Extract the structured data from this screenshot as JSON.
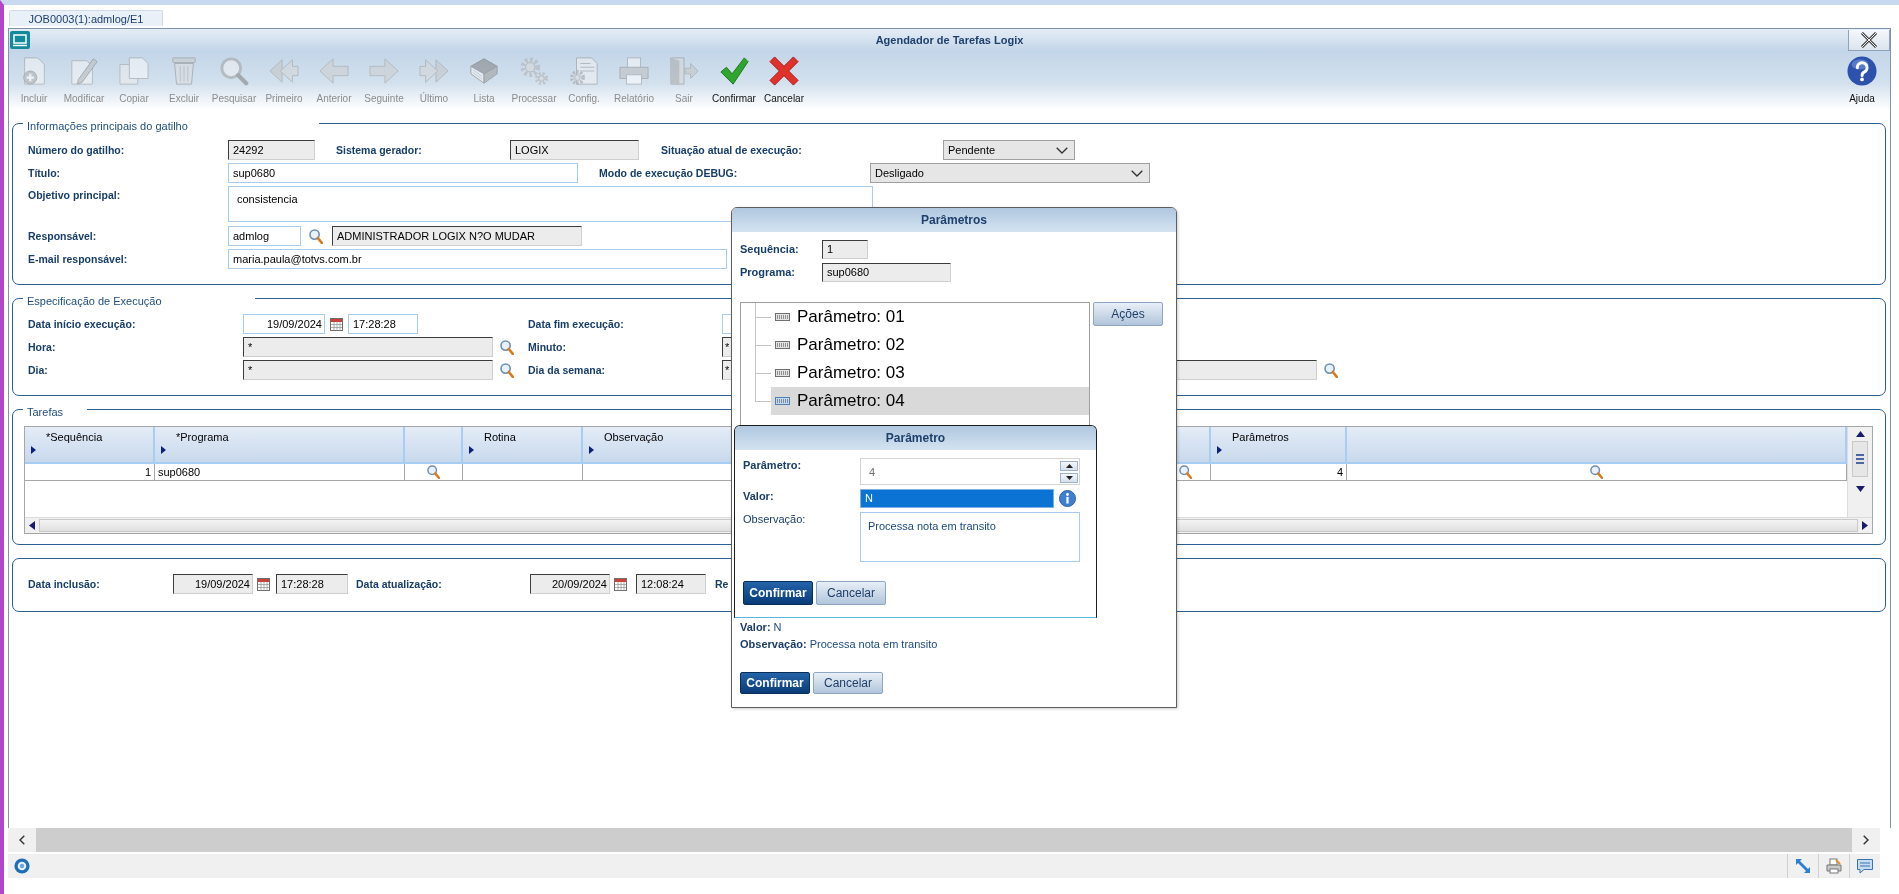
{
  "tabs": [
    {
      "label": "JOB0003(1):admlog/E1",
      "selected": true
    }
  ],
  "window": {
    "title": "Agendador de Tarefas Logix"
  },
  "toolbar": [
    {
      "label": "Incluir",
      "disabled": true
    },
    {
      "label": "Modificar",
      "disabled": true
    },
    {
      "label": "Copiar",
      "disabled": true
    },
    {
      "label": "Excluir",
      "disabled": true
    },
    {
      "label": "Pesquisar",
      "disabled": true
    },
    {
      "label": "Primeiro",
      "disabled": true
    },
    {
      "label": "Anterior",
      "disabled": true
    },
    {
      "label": "Seguinte",
      "disabled": true
    },
    {
      "label": "Último",
      "disabled": true
    },
    {
      "label": "Lista",
      "disabled": true
    },
    {
      "label": "Processar",
      "disabled": true
    },
    {
      "label": "Config.",
      "disabled": true
    },
    {
      "label": "Relatório",
      "disabled": true
    },
    {
      "label": "Sair",
      "disabled": true
    },
    {
      "label": "Confirmar",
      "disabled": false
    },
    {
      "label": "Cancelar",
      "disabled": false
    }
  ],
  "help": {
    "label": "Ajuda"
  },
  "trigger_info": {
    "legend": "Informações principais do gatilho",
    "trigger_number": {
      "label": "Número do gatilho:",
      "field": {
        "value": "24292",
        "readonly": true
      }
    },
    "source_system": {
      "label": "Sistema gerador:",
      "field": {
        "value": "LOGIX",
        "readonly": true
      }
    },
    "execution_status": {
      "label": "Situação atual de execução:",
      "value": "Pendente"
    },
    "title": {
      "label": "Título:",
      "field": {
        "value": "sup0680",
        "readonly": false
      }
    },
    "debug_mode": {
      "label": "Modo de execução DEBUG:",
      "value": "Desligado"
    },
    "objective": {
      "label": "Objetivo principal:",
      "value": "consistencia"
    },
    "owner": {
      "label": "Responsável:",
      "code": {
        "value": "admlog",
        "readonly": false
      },
      "name": {
        "value": "ADMINISTRADOR LOGIX N?O MUDAR",
        "readonly": true
      }
    },
    "owner_email": {
      "label": "E-mail responsável:",
      "field": {
        "value": "maria.paula@totvs.com.br",
        "readonly": false
      }
    }
  },
  "execution_spec": {
    "legend": "Especificação de Execução",
    "start": {
      "label": "Data início execução:",
      "date": {
        "value": "19/09/2024",
        "readonly": false
      },
      "time": {
        "value": "17:28:28",
        "readonly": false
      }
    },
    "end": {
      "label": "Data fim execução:",
      "date": {
        "readonly": false
      }
    },
    "hour": {
      "label": "Hora:",
      "field": {
        "value": "*",
        "readonly": true
      }
    },
    "minute": {
      "label": "Minuto:",
      "field": {
        "value": "*",
        "readonly": true
      }
    },
    "day": {
      "label": "Dia:",
      "field": {
        "value": "*",
        "readonly": true
      }
    },
    "weekday": {
      "label": "Dia da semana:",
      "field": {
        "value": "*",
        "readonly": true
      }
    }
  },
  "tasks": {
    "legend": "Tarefas",
    "columns": [
      {
        "kind": "labeled",
        "label": "*Sequência"
      },
      {
        "kind": "labeled",
        "label": "*Programa"
      },
      {
        "kind": "blank"
      },
      {
        "kind": "labeled",
        "label": "Rotina"
      },
      {
        "kind": "labeled",
        "label": "Observação"
      },
      {
        "kind": "blank"
      },
      {
        "kind": "labeled",
        "label": "Parâmetros"
      },
      {
        "kind": "blank"
      }
    ],
    "rows": [
      {
        "cells": [
          {
            "kind": "number",
            "text": "1"
          },
          {
            "kind": "text",
            "text": "sup0680"
          },
          {
            "kind": "lookup"
          },
          {
            "kind": "empty"
          },
          {
            "kind": "empty"
          },
          {
            "kind": "lookup"
          },
          {
            "kind": "number",
            "text": "4"
          },
          {
            "kind": "lookup"
          }
        ]
      }
    ]
  },
  "audit": {
    "created": {
      "label": "Data inclusão:",
      "date": {
        "value": "19/09/2024",
        "readonly": true
      },
      "time": {
        "value": "17:28:28",
        "readonly": true
      }
    },
    "updated": {
      "label": "Data atualização:",
      "date": {
        "value": "20/09/2024",
        "readonly": true
      },
      "time": {
        "value": "12:08:24",
        "readonly": true
      }
    },
    "label_3": "Re"
  },
  "parameters_dialog": {
    "title": "Parâmetros",
    "sequence": {
      "label": "Sequência:",
      "field": {
        "value": "1",
        "readonly": true
      }
    },
    "program": {
      "label": "Programa:",
      "field": {
        "value": "sup0680",
        "readonly": true
      }
    },
    "tree": [
      {
        "label": "Parâmetro: 01",
        "selected": false
      },
      {
        "label": "Parâmetro: 02",
        "selected": false
      },
      {
        "label": "Parâmetro: 03",
        "selected": false
      },
      {
        "label": "Parâmetro: 04",
        "selected": true
      }
    ],
    "actions_button": "Ações",
    "summary": [
      {
        "label": "Valor:",
        "value": "N"
      },
      {
        "label": "Observação:",
        "value": "Processa nota em transito"
      }
    ],
    "buttons": [
      {
        "label": "Confirmar",
        "kind": "primary"
      },
      {
        "label": "Cancelar",
        "kind": "secondary"
      }
    ]
  },
  "parameter_dialog": {
    "title": "Parâmetro",
    "fields": [
      {
        "kind": "spinner",
        "label": "Parâmetro:",
        "value": "4",
        "required": true,
        "disabled": true,
        "highlighted": false
      },
      {
        "kind": "text",
        "label": "Valor:",
        "value": "N",
        "required": true,
        "disabled": false,
        "highlighted": true
      },
      {
        "kind": "textarea",
        "label": "Observação:",
        "value": "Processa nota em transito",
        "required": false,
        "disabled": false,
        "highlighted": false
      }
    ],
    "buttons": [
      {
        "label": "Confirmar",
        "kind": "primary"
      },
      {
        "label": "Cancelar",
        "kind": "secondary"
      }
    ]
  }
}
